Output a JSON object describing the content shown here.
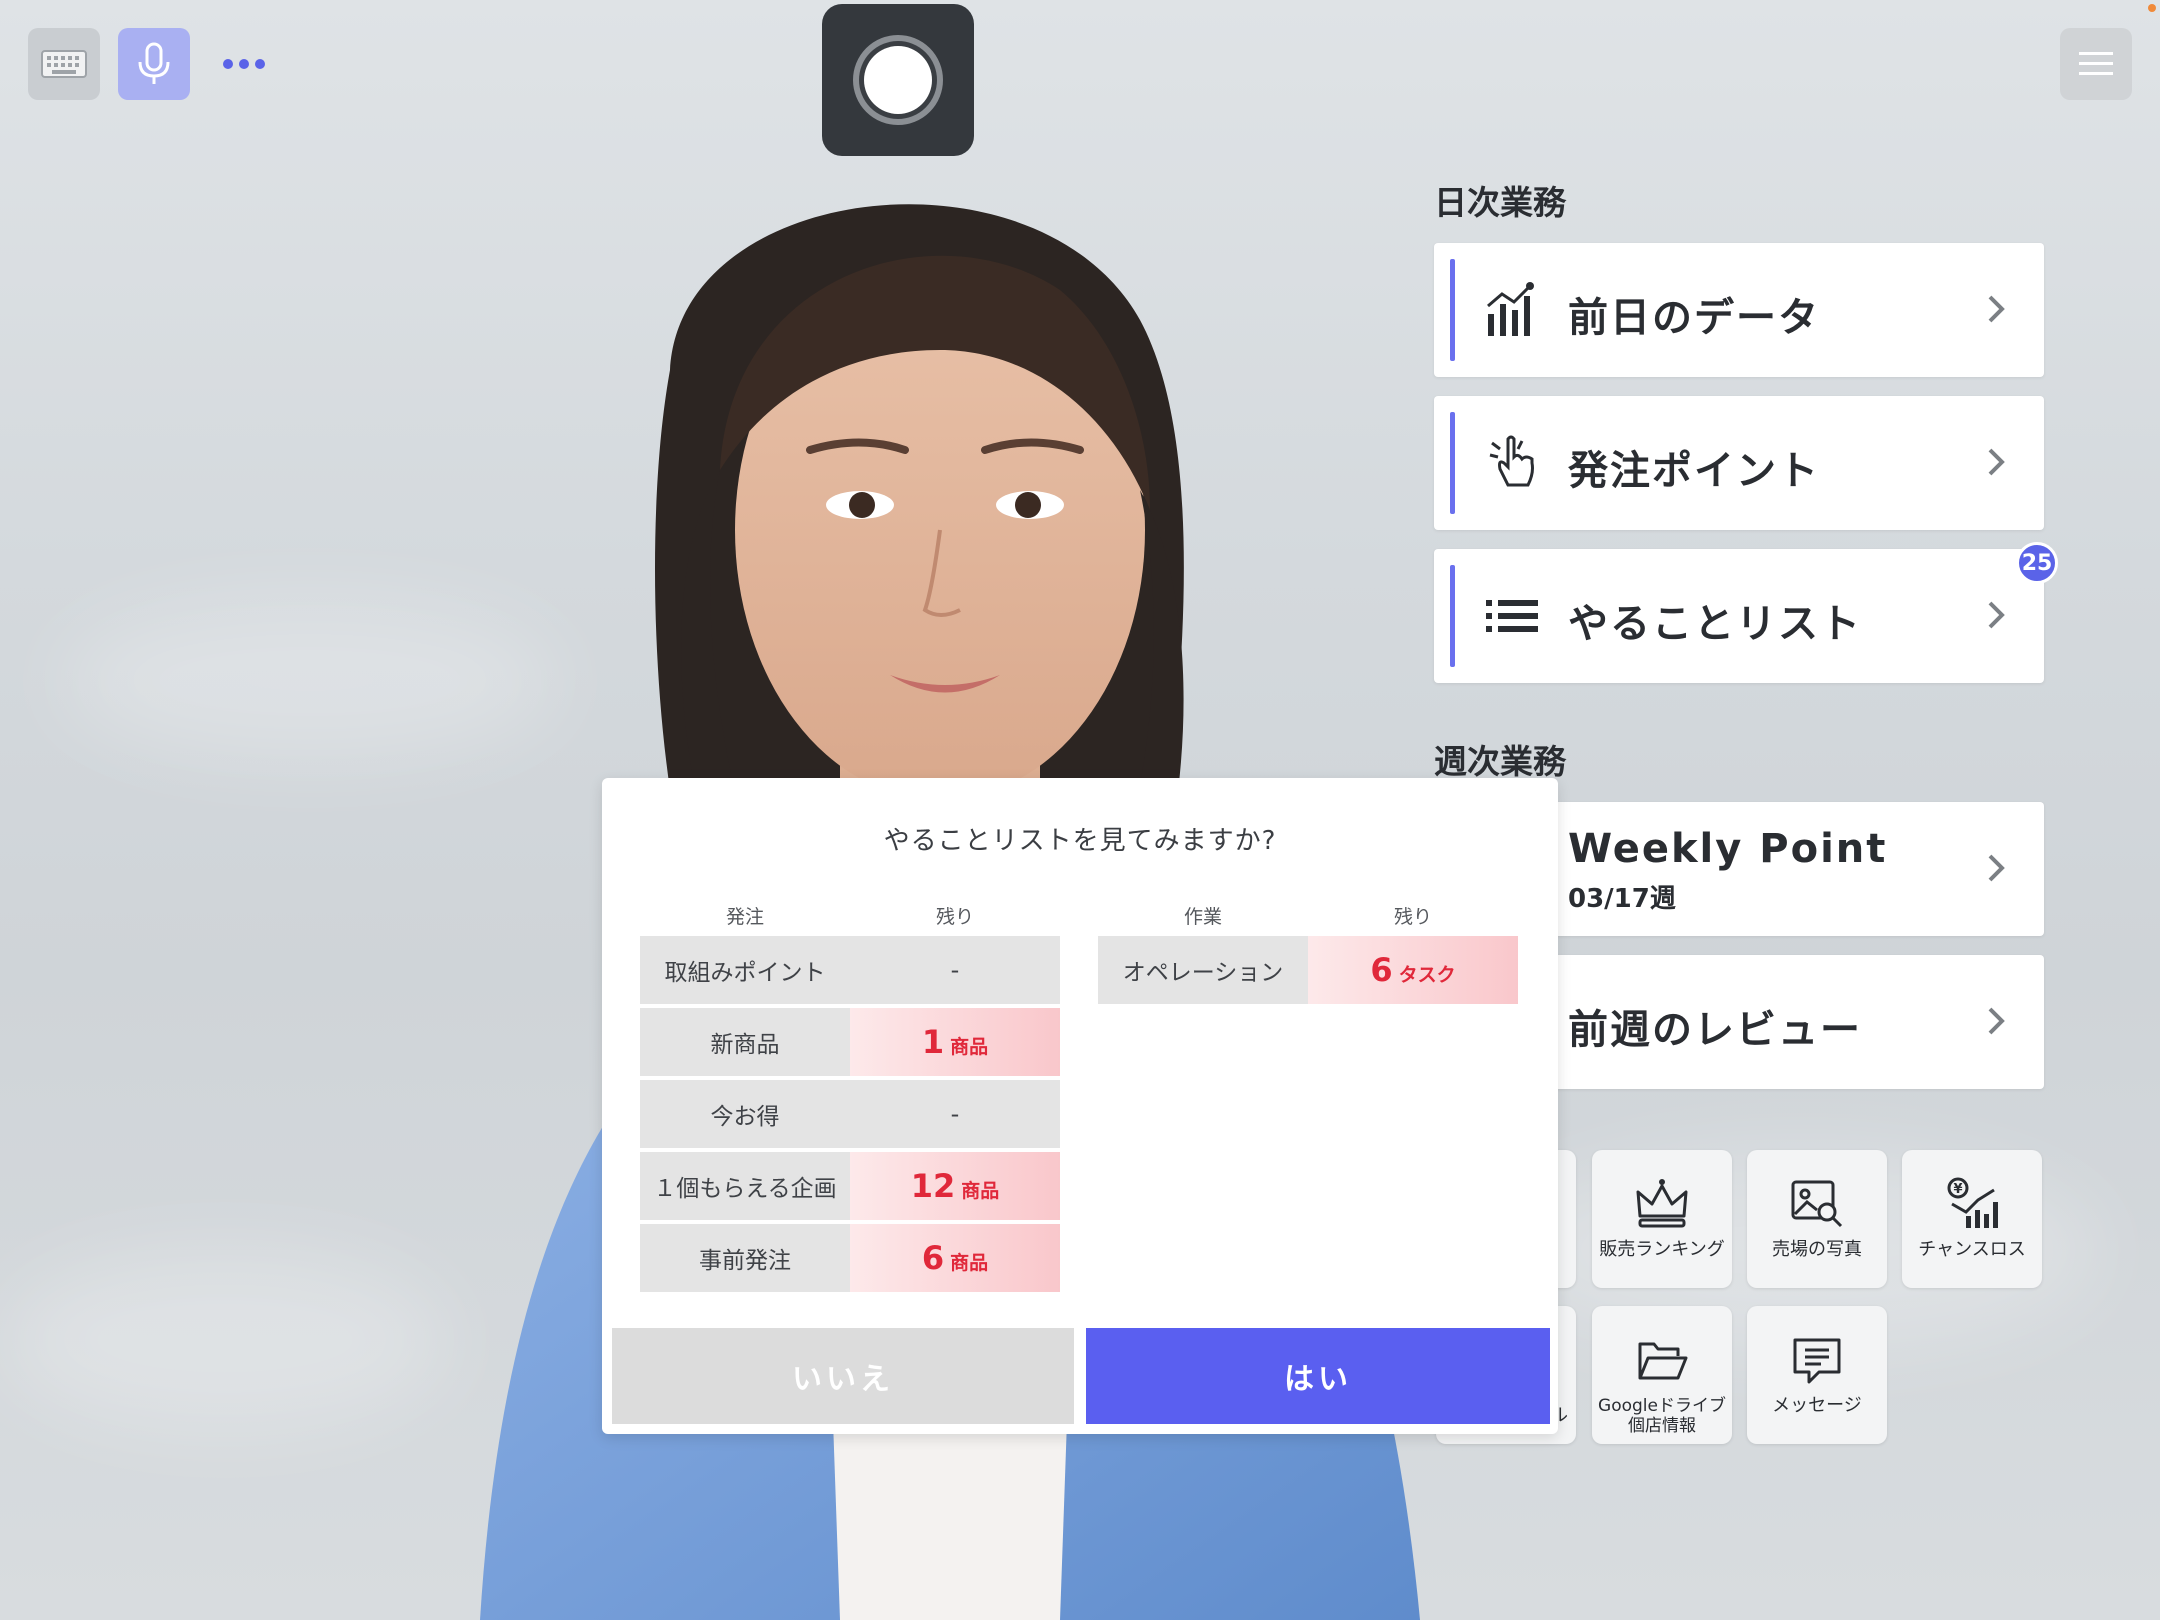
{
  "topbar": {
    "keyboard_icon": "keyboard-icon",
    "mic_icon": "microphone-icon",
    "more_icon": "more-dots-icon",
    "record_icon": "record-icon",
    "menu_icon": "hamburger-menu-icon"
  },
  "daily": {
    "title": "日次業務",
    "items": [
      {
        "label": "前日のデータ",
        "icon": "bar-chart-icon"
      },
      {
        "label": "発注ポイント",
        "icon": "pointing-hand-icon"
      },
      {
        "label": "やることリスト",
        "icon": "list-icon",
        "badge": "25"
      }
    ]
  },
  "weekly": {
    "title": "週次業務",
    "items": [
      {
        "label": "Weekly Point",
        "sub": "03/17週"
      },
      {
        "label": "前週のレビュー"
      }
    ]
  },
  "tiles": [
    {
      "label": "販売ランキング",
      "icon": "crown-icon"
    },
    {
      "label": "売場の写真",
      "icon": "photo-search-icon"
    },
    {
      "label": "チャンスロス",
      "icon": "yen-chart-icon"
    },
    {
      "label": "ル",
      "icon": ""
    },
    {
      "label": "Googleドライブ 個店情報",
      "line1": "Googleドライブ",
      "line2": "個店情報",
      "icon": "folder-open-icon"
    },
    {
      "label": "メッセージ",
      "icon": "message-icon"
    }
  ],
  "dialog": {
    "question": "やることリストを見てみますか?",
    "order_header": "発注",
    "remaining_header": "残り",
    "work_header": "作業",
    "remaining_header2": "残り",
    "order_rows": [
      {
        "category": "取組みポイント",
        "value": "-",
        "unit": ""
      },
      {
        "category": "新商品",
        "value": "1",
        "unit": "商品"
      },
      {
        "category": "今お得",
        "value": "-",
        "unit": ""
      },
      {
        "category": "１個もらえる企画",
        "value": "12",
        "unit": "商品"
      },
      {
        "category": "事前発注",
        "value": "6",
        "unit": "商品"
      }
    ],
    "work_rows": [
      {
        "category": "オペレーション",
        "value": "6",
        "unit": "タスク"
      }
    ],
    "no_label": "いいえ",
    "yes_label": "はい"
  },
  "colors": {
    "accent": "#5a5ff0",
    "alert_red": "#e0283a",
    "badge": "#5a63e8"
  }
}
